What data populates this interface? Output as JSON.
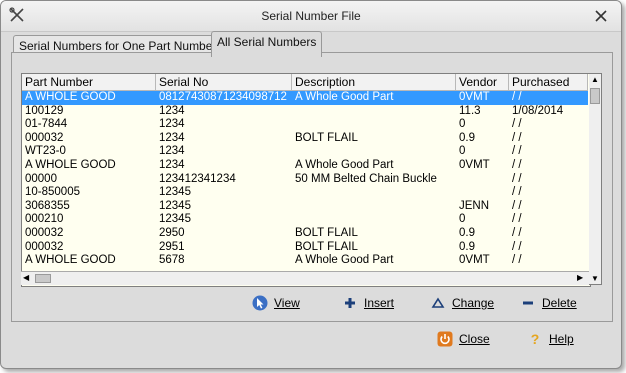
{
  "window": {
    "title": "Serial Number File"
  },
  "tabs": [
    {
      "label": "Serial Numbers for One Part Number",
      "active": false
    },
    {
      "label": "All Serial Numbers",
      "active": true
    }
  ],
  "table": {
    "columns": [
      "Part Number",
      "Serial No",
      "Description",
      "Vendor",
      "Purchased"
    ],
    "selected_row": 0,
    "rows": [
      [
        "A WHOLE GOOD",
        "08127430871234098712",
        "A Whole Good Part",
        "0VMT",
        " / /"
      ],
      [
        "100129",
        "1234",
        "",
        "11.3",
        "1/08/2014"
      ],
      [
        "01-7844",
        "1234",
        "",
        "0",
        " / /"
      ],
      [
        "000032",
        "1234",
        "BOLT FLAIL",
        "0.9",
        " / /"
      ],
      [
        "WT23-0",
        "1234",
        "",
        "0",
        " / /"
      ],
      [
        "A WHOLE GOOD",
        "1234",
        "A Whole Good Part",
        "0VMT",
        " / /"
      ],
      [
        "00000",
        "123412341234",
        "50 MM Belted Chain Buckle",
        "",
        " / /"
      ],
      [
        "10-850005",
        "12345",
        "",
        "",
        " / /"
      ],
      [
        "3068355",
        "12345",
        "",
        "JENN",
        " / /"
      ],
      [
        "000210",
        "12345",
        "",
        "0",
        " / /"
      ],
      [
        "000032",
        "2950",
        "BOLT FLAIL",
        "0.9",
        " / /"
      ],
      [
        "000032",
        "2951",
        "BOLT FLAIL",
        "0.9",
        " / /"
      ],
      [
        "A WHOLE GOOD",
        "5678",
        "A Whole Good Part",
        "0VMT",
        " / /"
      ]
    ]
  },
  "actions": {
    "view": "View",
    "insert": "Insert",
    "change": "Change",
    "delete": "Delete"
  },
  "footer": {
    "close": "Close",
    "help": "Help"
  },
  "colors": {
    "selection": "#3399ff",
    "grid_background": "#fffff0",
    "dialog_background": "#dcdcdc"
  },
  "icons": [
    "app-tools-icon",
    "close-icon",
    "view-cursor-icon",
    "insert-plus-icon",
    "change-triangle-icon",
    "delete-minus-icon",
    "power-icon",
    "help-question-icon"
  ]
}
